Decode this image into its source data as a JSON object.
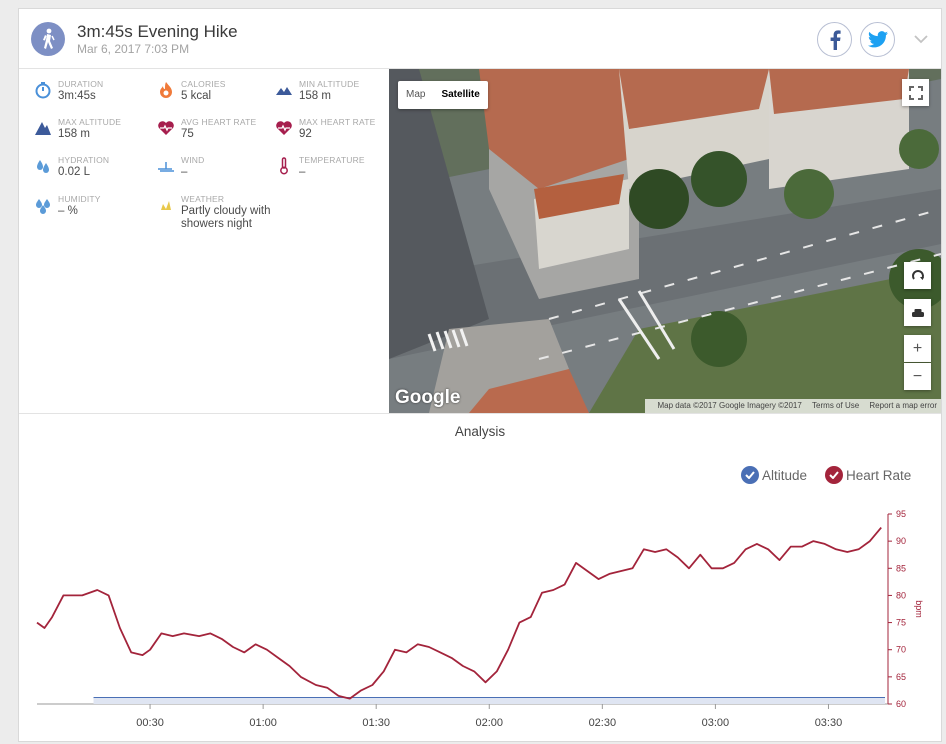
{
  "activity": {
    "title": "3m:45s Evening Hike",
    "date": "Mar 6, 2017 7:03 PM",
    "icon": "hiker-icon"
  },
  "share": {
    "facebook_icon": "facebook-icon",
    "twitter_icon": "twitter-icon",
    "expand_icon": "chevron-down-icon"
  },
  "stats": [
    {
      "label": "DURATION",
      "value": "3m:45s",
      "icon": "stopwatch-icon",
      "color": "#4a90d9"
    },
    {
      "label": "CALORIES",
      "value": "5 kcal",
      "icon": "flame-icon",
      "color": "#f07a3a"
    },
    {
      "label": "MIN ALTITUDE",
      "value": "158 m",
      "icon": "mountain-low-icon",
      "color": "#3c5a9a"
    },
    {
      "label": "MAX ALTITUDE",
      "value": "158 m",
      "icon": "mountain-high-icon",
      "color": "#3c5a9a"
    },
    {
      "label": "AVG HEART RATE",
      "value": "75",
      "icon": "heart-pulse-icon",
      "color": "#a61e4d"
    },
    {
      "label": "MAX HEART RATE",
      "value": "92",
      "icon": "heart-pulse-max-icon",
      "color": "#a61e4d"
    },
    {
      "label": "HYDRATION",
      "value": "0.02 L",
      "icon": "drops-icon",
      "color": "#5b9bd8"
    },
    {
      "label": "WIND",
      "value": "–",
      "icon": "wind-icon",
      "color": "#4a90d9"
    },
    {
      "label": "TEMPERATURE",
      "value": "–",
      "icon": "thermometer-icon",
      "color": "#a61e4d"
    },
    {
      "label": "HUMIDITY",
      "value": "– %",
      "icon": "humidity-icon",
      "color": "#5b9bd8"
    },
    {
      "label": "WEATHER",
      "value": "Partly cloudy with showers night",
      "icon": "weather-icon",
      "color": "#e8c84a"
    }
  ],
  "map": {
    "type_map": "Map",
    "type_satellite": "Satellite",
    "logo": "Google",
    "attribution": "Map data ©2017 Google Imagery ©2017",
    "terms": "Terms of Use",
    "report": "Report a map error",
    "zoom_in": "+",
    "zoom_out": "−"
  },
  "analysis": {
    "title": "Analysis",
    "legend": [
      {
        "name": "Altitude",
        "color": "#4a6fb5"
      },
      {
        "name": "Heart Rate",
        "color": "#a3243b"
      }
    ]
  },
  "chart_data": {
    "type": "line",
    "x_ticks": [
      "00:30",
      "01:00",
      "01:30",
      "02:00",
      "02:30",
      "03:00",
      "03:30"
    ],
    "y_right_ticks": [
      "60",
      "65",
      "70",
      "75",
      "80",
      "85",
      "90",
      "95"
    ],
    "y_right_label": "bpm",
    "ylim": [
      60,
      95
    ],
    "xlim_seconds": [
      0,
      225
    ],
    "series": [
      {
        "name": "Heart Rate",
        "color": "#a3243b",
        "x_seconds": [
          0,
          2,
          4,
          7,
          10,
          12,
          16,
          19,
          22,
          25,
          28,
          30,
          33,
          36,
          39,
          43,
          46,
          49,
          52,
          55,
          58,
          61,
          64,
          67,
          70,
          74,
          77,
          80,
          83,
          86,
          89,
          92,
          95,
          98,
          101,
          104,
          107,
          110,
          113,
          116,
          119,
          122,
          125,
          128,
          131,
          134,
          137,
          140,
          143,
          146,
          149,
          152,
          155,
          158,
          161,
          164,
          167,
          170,
          173,
          176,
          179,
          182,
          185,
          188,
          191,
          194,
          197,
          200,
          203,
          206,
          209,
          212,
          215,
          218,
          221,
          224
        ],
        "values": [
          75,
          74,
          76,
          80,
          80,
          80,
          81,
          80,
          74,
          69.5,
          69,
          70,
          73,
          72.5,
          73,
          72.5,
          73,
          72,
          70.5,
          69.5,
          71,
          70,
          68.5,
          67,
          65,
          63.5,
          63,
          61.5,
          61,
          62.5,
          63.5,
          66,
          70,
          69.5,
          71,
          70.5,
          69.5,
          68.5,
          67,
          66,
          64,
          66,
          70,
          75,
          76,
          80.5,
          81,
          82,
          86,
          84.5,
          83,
          84,
          84.5,
          85,
          88.5,
          88,
          88.5,
          87,
          85,
          87.5,
          85,
          85,
          86,
          88.5,
          89.5,
          88.5,
          86.5,
          89,
          89,
          90,
          89.5,
          88.5,
          88,
          88.5,
          90,
          92.5
        ]
      },
      {
        "name": "Altitude",
        "color": "#4a6fb5",
        "x_seconds": [
          15,
          225
        ],
        "values": [
          158,
          158
        ]
      }
    ]
  }
}
